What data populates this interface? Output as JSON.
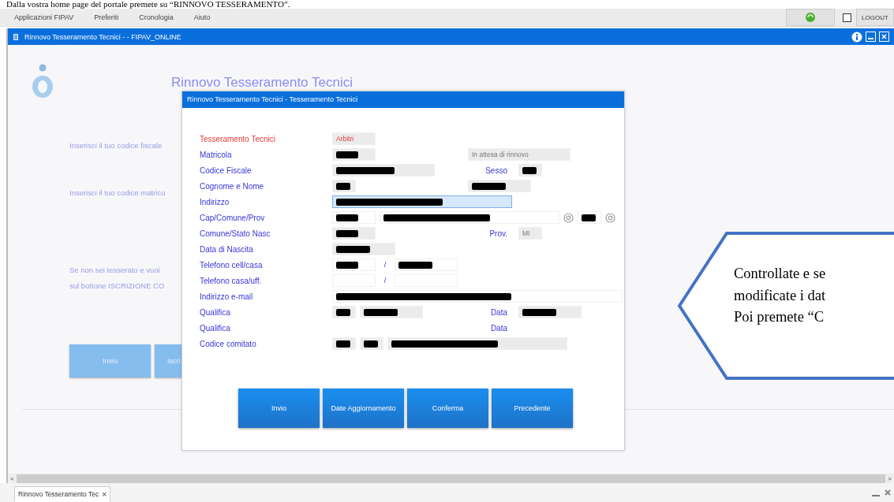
{
  "caption": "Dalla vostra home page del portale premete su “RINNOVO TESSERAMENTO”.",
  "menu": [
    {
      "label": "Applicazioni FIPAV"
    },
    {
      "label": "Preferiti"
    },
    {
      "label": "Cronologia"
    },
    {
      "label": "Aiuto"
    }
  ],
  "toolbar": {
    "checkbox": {
      "checked": false
    },
    "logout": "LOGOUT"
  },
  "window": {
    "title": "Rinnovo Tesseramento Tecnici - - FIPAV_ONLINE"
  },
  "page": {
    "heading": "Rinnovo Tesseramento Tecnici",
    "texts": [
      "Inserisci il tuo codice fiscale",
      "Inserisci il tuo codice matrico"
    ],
    "paragraph": [
      "Se non sei tesserato e vuoi",
      "sul bottone ISCRIZIONE CO"
    ],
    "buttons": [
      "Invio",
      "Iscri"
    ]
  },
  "dialog": {
    "title": "Rinnovo Tesseramento Tecnici - Tesseramento Tecnici",
    "rows": [
      {
        "label": "Tesseramento Tecnici",
        "kind": "header",
        "fields": [
          {
            "kind": "readonly",
            "value": "Arbitri"
          }
        ]
      },
      {
        "label": "Matricola",
        "kind": "field",
        "fields": [
          {
            "kind": "readonly-redacted"
          }
        ],
        "side": [
          {
            "kind": "readonly",
            "value": "In attesa di rinnovo"
          }
        ]
      },
      {
        "label": "Codice Fiscale",
        "kind": "field",
        "fields": [
          {
            "kind": "readonly-redacted"
          }
        ],
        "side": [
          {
            "kind": "label",
            "text": "Sesso"
          },
          {
            "kind": "readonly-redacted"
          }
        ]
      },
      {
        "label": "Cognome e Nome",
        "kind": "field",
        "fields": [
          {
            "kind": "readonly-redacted"
          }
        ],
        "side": [
          {
            "kind": "readonly-redacted"
          }
        ]
      },
      {
        "label": "Indirizzo",
        "kind": "field",
        "fields": [
          {
            "kind": "focused-redacted"
          }
        ]
      },
      {
        "label": "Cap/Comune/Prov",
        "kind": "field",
        "fields": [
          {
            "kind": "input-redacted"
          },
          {
            "kind": "input-redacted"
          },
          {
            "kind": "lookup"
          },
          {
            "kind": "input-redacted"
          },
          {
            "kind": "lookup"
          }
        ]
      },
      {
        "label": "Comune/Stato Nasc",
        "kind": "field",
        "fields": [
          {
            "kind": "readonly-redacted"
          }
        ],
        "side": [
          {
            "kind": "label",
            "text": "Prov."
          },
          {
            "kind": "readonly",
            "value": "MI"
          }
        ]
      },
      {
        "label": "Data di Nascita",
        "kind": "field",
        "fields": [
          {
            "kind": "readonly-redacted"
          }
        ]
      },
      {
        "label": "Telefono cell/casa",
        "kind": "field",
        "fields": [
          {
            "kind": "input-redacted"
          },
          {
            "kind": "separator",
            "text": "/"
          },
          {
            "kind": "input-redacted"
          }
        ]
      },
      {
        "label": "Telefono casa/uff.",
        "kind": "field",
        "fields": [
          {
            "kind": "input"
          },
          {
            "kind": "separator",
            "text": "/"
          },
          {
            "kind": "input"
          }
        ]
      },
      {
        "label": "Indirizzo e-mail",
        "kind": "field",
        "fields": [
          {
            "kind": "input-redacted"
          }
        ]
      },
      {
        "label": "Qualifica",
        "kind": "field",
        "fields": [
          {
            "kind": "readonly-redacted"
          },
          {
            "kind": "readonly-redacted"
          }
        ],
        "side": [
          {
            "kind": "label",
            "text": "Data"
          },
          {
            "kind": "readonly-redacted"
          }
        ]
      },
      {
        "label": "Qualifica",
        "kind": "field",
        "fields": [],
        "side": [
          {
            "kind": "label",
            "text": "Data"
          }
        ]
      },
      {
        "label": "Codice comitato",
        "kind": "field",
        "fields": [
          {
            "kind": "readonly-redacted"
          },
          {
            "kind": "readonly-redacted"
          },
          {
            "kind": "readonly-redacted"
          }
        ]
      }
    ],
    "buttons": [
      "Invio",
      "Date Aggiornamento",
      "Conferma",
      "Precedente"
    ]
  },
  "callout": [
    "Controllate e se",
    "modificate i dat",
    "Poi premete “C"
  ],
  "scrollbar": {
    "left": "<",
    "right": ">"
  },
  "tabs": [
    {
      "label": "Rinnovo Tesseramento Tec",
      "selected": true,
      "close": "×"
    }
  ]
}
